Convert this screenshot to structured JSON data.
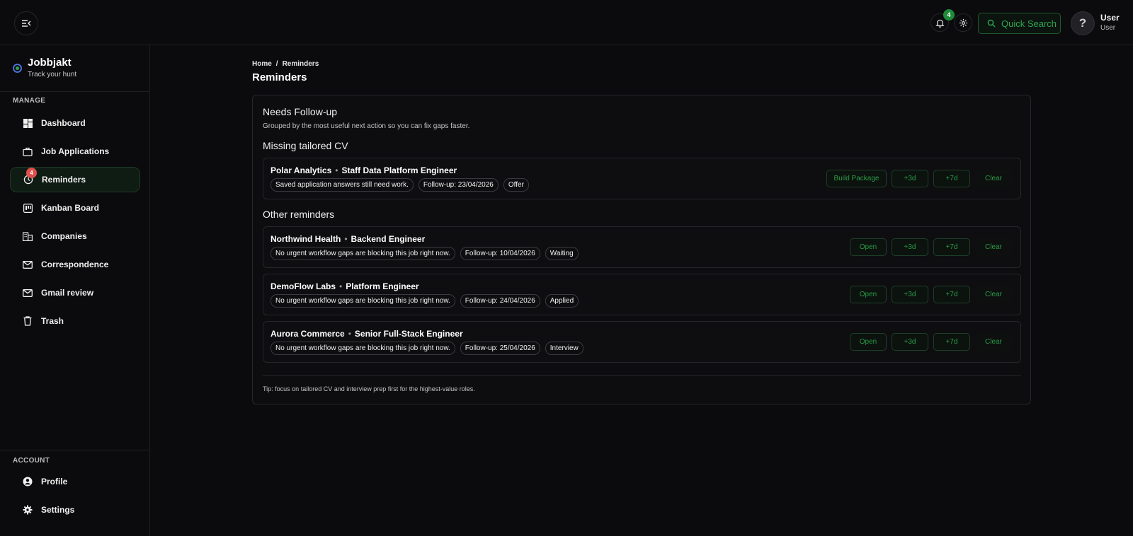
{
  "header": {
    "notifications_count": "4",
    "quick_search_label": "Quick Search",
    "user": {
      "avatar_glyph": "?",
      "name": "User",
      "role": "User"
    }
  },
  "sidebar": {
    "brand": {
      "title": "Jobbjakt",
      "subtitle": "Track your hunt"
    },
    "manage_label": "MANAGE",
    "items": [
      {
        "label": "Dashboard",
        "icon": "dashboard-icon"
      },
      {
        "label": "Job Applications",
        "icon": "briefcase-icon"
      },
      {
        "label": "Reminders",
        "icon": "clock-icon",
        "badge": "4",
        "active": true
      },
      {
        "label": "Kanban Board",
        "icon": "kanban-icon"
      },
      {
        "label": "Companies",
        "icon": "building-icon"
      },
      {
        "label": "Correspondence",
        "icon": "mail-icon"
      },
      {
        "label": "Gmail review",
        "icon": "mail-icon"
      },
      {
        "label": "Trash",
        "icon": "trash-icon"
      }
    ],
    "account_label": "ACCOUNT",
    "account_items": [
      {
        "label": "Profile",
        "icon": "user-circle-icon"
      },
      {
        "label": "Settings",
        "icon": "gear-icon"
      }
    ]
  },
  "main": {
    "breadcrumb": {
      "home": "Home",
      "separator": "/",
      "current": "Reminders"
    },
    "title": "Reminders",
    "card": {
      "title": "Needs Follow-up",
      "subtitle": "Grouped by the most useful next action so you can fix gaps faster.",
      "groups": [
        {
          "title": "Missing tailored CV",
          "rows": [
            {
              "company": "Polar Analytics",
              "sep": "•",
              "role": "Staff Data Platform Engineer",
              "chips": [
                "Saved application answers still need work.",
                "Follow-up: 23/04/2026",
                "Offer"
              ],
              "primary_action": "Build Package",
              "plus3": "+3d",
              "plus7": "+7d",
              "clear": "Clear"
            }
          ]
        },
        {
          "title": "Other reminders",
          "rows": [
            {
              "company": "Northwind Health",
              "sep": "•",
              "role": "Backend Engineer",
              "chips": [
                "No urgent workflow gaps are blocking this job right now.",
                "Follow-up: 10/04/2026",
                "Waiting"
              ],
              "primary_action": "Open",
              "plus3": "+3d",
              "plus7": "+7d",
              "clear": "Clear"
            },
            {
              "company": "DemoFlow Labs",
              "sep": "•",
              "role": "Platform Engineer",
              "chips": [
                "No urgent workflow gaps are blocking this job right now.",
                "Follow-up: 24/04/2026",
                "Applied"
              ],
              "primary_action": "Open",
              "plus3": "+3d",
              "plus7": "+7d",
              "clear": "Clear"
            },
            {
              "company": "Aurora Commerce",
              "sep": "•",
              "role": "Senior Full-Stack Engineer",
              "chips": [
                "No urgent workflow gaps are blocking this job right now.",
                "Follow-up: 25/04/2026",
                "Interview"
              ],
              "primary_action": "Open",
              "plus3": "+3d",
              "plus7": "+7d",
              "clear": "Clear"
            }
          ]
        }
      ],
      "tip": "Tip: focus on tailored CV and interview prep first for the highest-value roles."
    }
  },
  "colors": {
    "accent": "#2fa44f",
    "badge_red": "#e0504a",
    "background": "#0b0b0d"
  }
}
